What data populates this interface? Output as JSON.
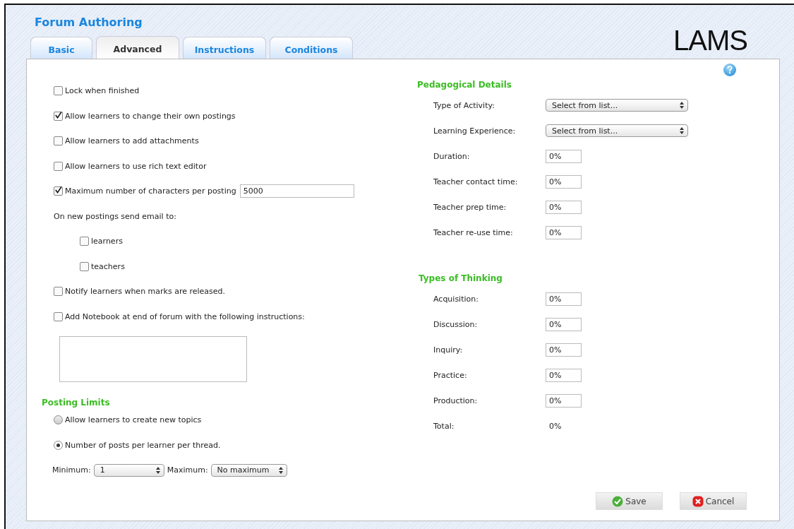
{
  "title": "Forum Authoring",
  "logo": "LAMS",
  "tabs": [
    {
      "label": "Basic",
      "selected": false
    },
    {
      "label": "Advanced",
      "selected": true
    },
    {
      "label": "Instructions",
      "selected": false
    },
    {
      "label": "Conditions",
      "selected": false
    }
  ],
  "options": [
    {
      "kind": "checkbox",
      "label": "Lock when finished",
      "checked": false
    },
    {
      "kind": "checkbox",
      "label": "Allow learners to change their own postings",
      "checked": true
    },
    {
      "kind": "checkbox",
      "label": "Allow learners to add attachments",
      "checked": false
    },
    {
      "kind": "checkbox",
      "label": "Allow learners to use rich text editor",
      "checked": false
    },
    {
      "kind": "checkbox_input",
      "label": "Maximum number of characters per posting",
      "checked": true,
      "value": "5000"
    },
    {
      "kind": "label",
      "label": "On new postings send email to:",
      "children": [
        {
          "label": "learners",
          "checked": false
        },
        {
          "label": "teachers",
          "checked": false
        }
      ]
    },
    {
      "kind": "checkbox",
      "label": "Notify learners when marks are released.",
      "checked": false
    },
    {
      "kind": "checkbox",
      "label": "Add Notebook at end of forum with the following instructions:",
      "checked": false
    }
  ],
  "posting_limits": {
    "heading": "Posting Limits",
    "radios": [
      {
        "label": "Allow learners to create new topics",
        "selected": false
      },
      {
        "label": "Number of posts per learner per thread.",
        "selected": true
      }
    ],
    "minimum": {
      "label": "Minimum:",
      "value": "1"
    },
    "maximum": {
      "label": "Maximum:",
      "value": "No maximum"
    }
  },
  "pedagogical": {
    "heading": "Pedagogical Details",
    "rows": [
      {
        "kind": "select",
        "label": "Type of Activity:",
        "value": "Select from list..."
      },
      {
        "kind": "select",
        "label": "Learning Experience:",
        "value": "Select from list..."
      },
      {
        "kind": "input",
        "label": "Duration:",
        "value": "0%"
      },
      {
        "kind": "input",
        "label": "Teacher contact time:",
        "value": "0%"
      },
      {
        "kind": "input",
        "label": "Teacher prep time:",
        "value": "0%"
      },
      {
        "kind": "input",
        "label": "Teacher re-use time:",
        "value": "0%"
      }
    ]
  },
  "thinking": {
    "heading": "Types of Thinking",
    "rows": [
      {
        "kind": "input",
        "label": "Acquisition:",
        "value": "0%"
      },
      {
        "kind": "input",
        "label": "Discussion:",
        "value": "0%"
      },
      {
        "kind": "input",
        "label": "Inquiry:",
        "value": "0%"
      },
      {
        "kind": "input",
        "label": "Practice:",
        "value": "0%"
      },
      {
        "kind": "input",
        "label": "Production:",
        "value": "0%"
      },
      {
        "kind": "text",
        "label": "Total:",
        "value": "0%"
      }
    ]
  },
  "buttons": [
    {
      "kind": "save",
      "label": "Save"
    },
    {
      "kind": "cancel",
      "label": "Cancel"
    }
  ]
}
